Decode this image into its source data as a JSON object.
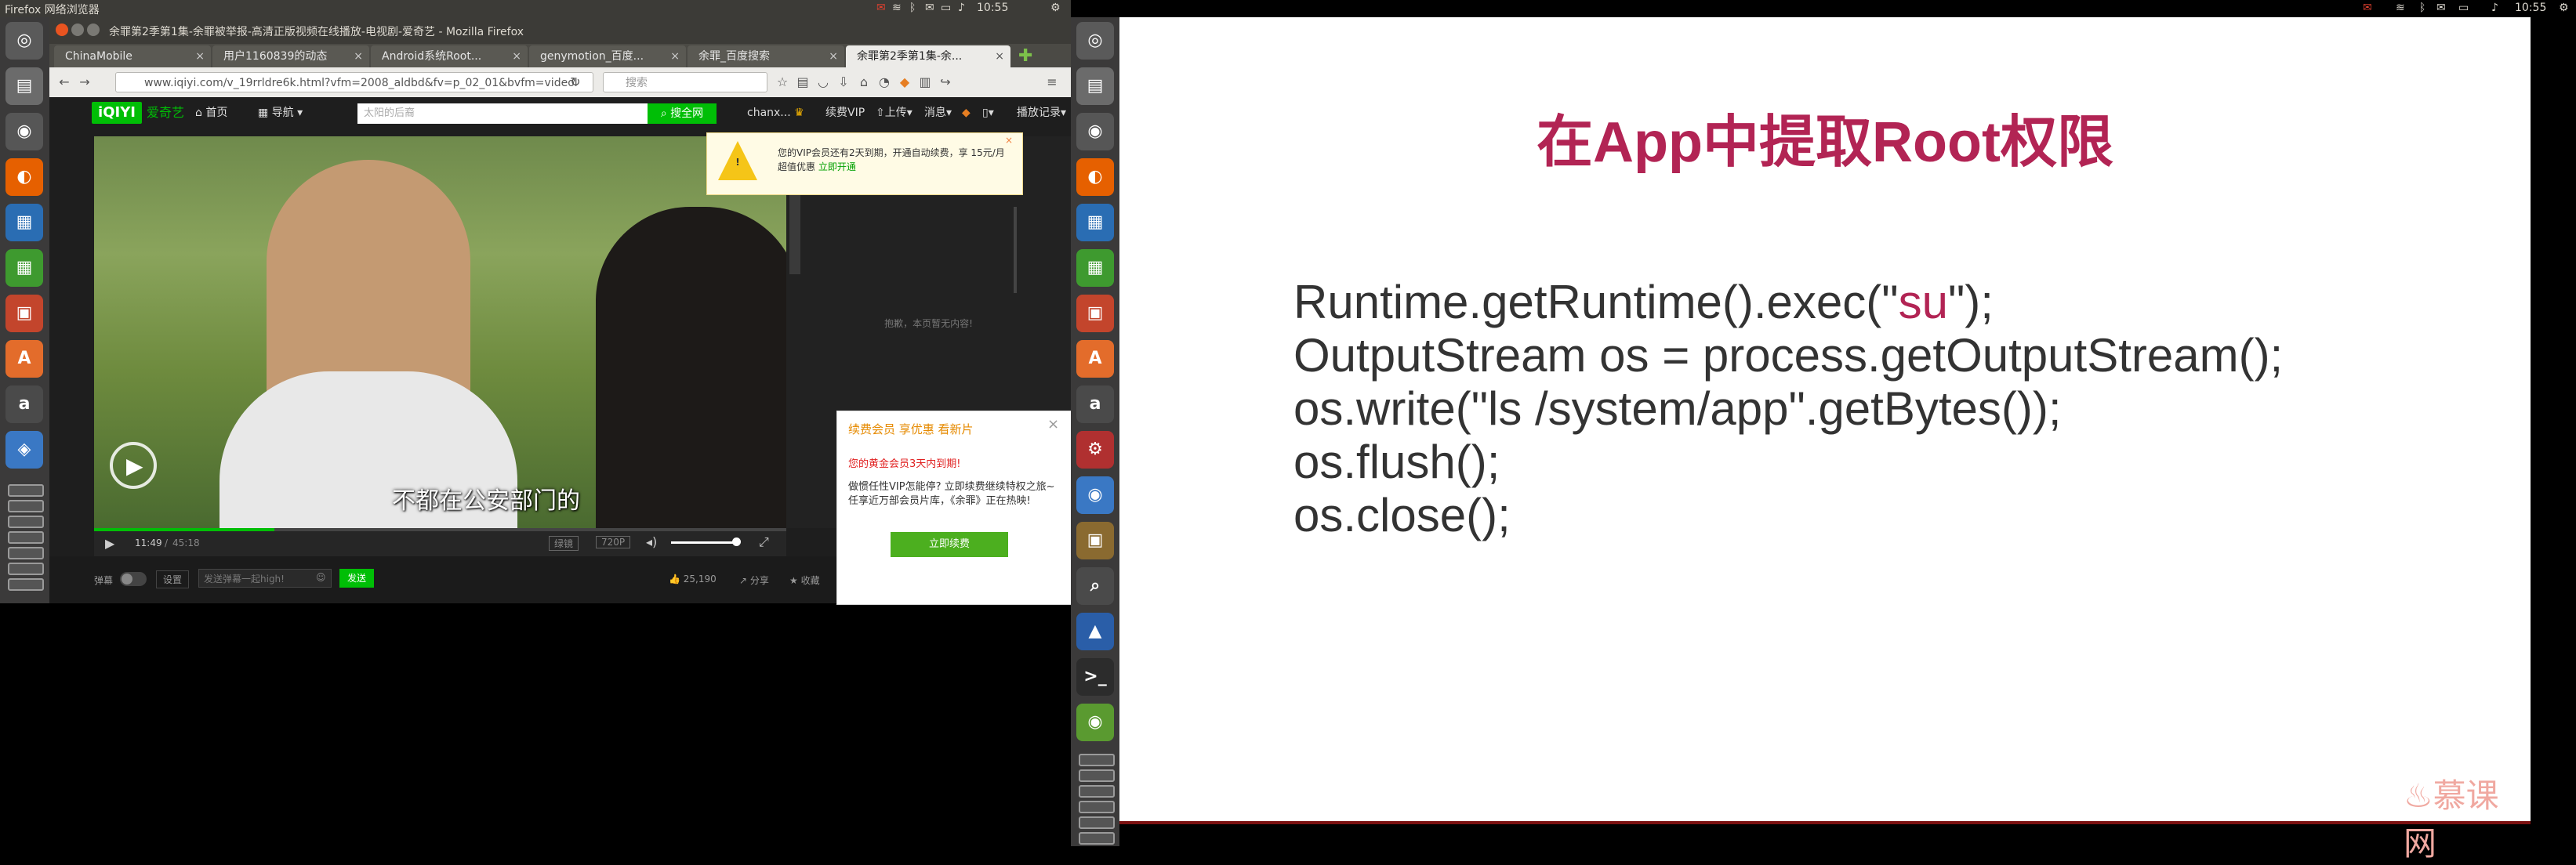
{
  "left_topbar": {
    "app_title": "Firefox 网络浏览器",
    "clock": "10:55"
  },
  "right_topbar": {
    "clock": "10:55"
  },
  "firefox": {
    "window_title": "余罪第2季第1集-余罪被举报-高清正版视频在线播放-电视剧-爱奇艺 - Mozilla Firefox",
    "tabs": [
      {
        "label": "ChinaMobile"
      },
      {
        "label": "用户1160839的动态"
      },
      {
        "label": "Android系统Root..."
      },
      {
        "label": "genymotion_百度..."
      },
      {
        "label": "余罪_百度搜索"
      },
      {
        "label": "余罪第2季第1集-余..."
      }
    ],
    "url": "www.iqiyi.com/v_19rrldre6k.html?vfm=2008_aldbd&fv=p_02_01&bvfm=videol",
    "search_placeholder": "搜索"
  },
  "iqiyi": {
    "logo": "爱奇艺",
    "logo_badge": "iQIYI",
    "nav_home": "首页",
    "nav_guide": "导航",
    "search_placeholder": "太阳的后裔",
    "search_button": "搜全网",
    "user": "chanx...",
    "renew_vip": "续费VIP",
    "upload": "上传",
    "messages": "消息",
    "history": "播放记录",
    "vip_notice": "您的VIP会员还有2天到期，开通自动续费，享 15元/月超值优惠",
    "vip_notice_link": "立即开通",
    "side_empty": "抱歉，本页暂无内容!",
    "subtitle": "不都在公安部门的",
    "time_current": "11:49",
    "time_total": "45:18",
    "quality_1": "绿镜",
    "quality_2": "720P",
    "danmu_label": "弹幕",
    "danmu_settings": "设置",
    "danmu_placeholder": "发送弹幕一起high!",
    "danmu_send": "发送",
    "likes": "25,190",
    "share": "分享",
    "collect": "收藏",
    "renew_popup": {
      "title": "续费会员 享优惠 看新片",
      "warning": "您的黄金会员3天内到期!",
      "body": "做惯任性VIP怎能停? 立即续费继续特权之旅~任享近万部会员片库，《余罪》正在热映!",
      "button": "立即续费"
    }
  },
  "slide": {
    "title": "在App中提取Root权限",
    "code_lines": {
      "l1_pre": "Runtime.getRuntime().exec(\"",
      "l1_su": "su",
      "l1_post": "\");",
      "l2": "OutputStream os = process.getOutputStream();",
      "l3": "os.write(\"ls /system/app\".getBytes());",
      "l4": "os.flush();",
      "l5": "os.close();"
    },
    "watermark": "慕课网"
  },
  "colors": {
    "accent": "#b22454",
    "iqiyi_green": "#00be06"
  }
}
